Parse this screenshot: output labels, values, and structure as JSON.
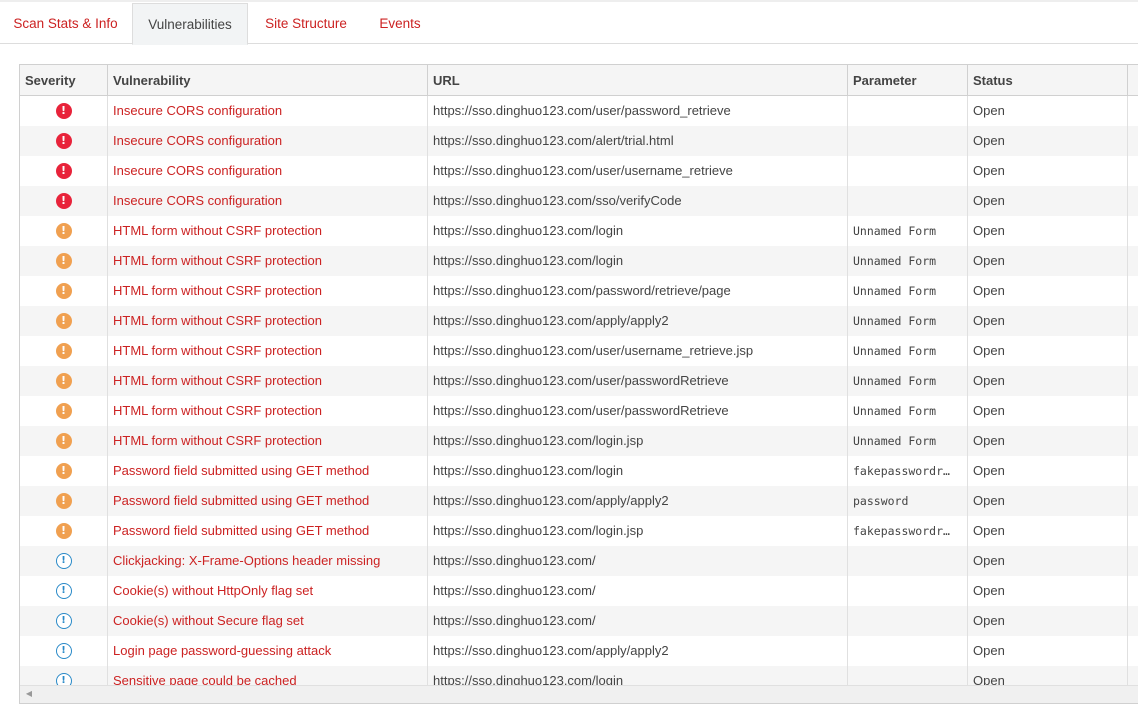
{
  "tabs": [
    {
      "label": "Scan Stats & Info",
      "active": false
    },
    {
      "label": "Vulnerabilities",
      "active": true
    },
    {
      "label": "Site Structure",
      "active": false
    },
    {
      "label": "Events",
      "active": false
    }
  ],
  "grid": {
    "columns": [
      "Severity",
      "Vulnerability",
      "URL",
      "Parameter",
      "Status"
    ],
    "rows": [
      {
        "severity": "high",
        "vulnerability": "Insecure CORS configuration",
        "url": "https://sso.dinghuo123.com/user/password_retrieve",
        "parameter": "",
        "status": "Open"
      },
      {
        "severity": "high",
        "vulnerability": "Insecure CORS configuration",
        "url": "https://sso.dinghuo123.com/alert/trial.html",
        "parameter": "",
        "status": "Open"
      },
      {
        "severity": "high",
        "vulnerability": "Insecure CORS configuration",
        "url": "https://sso.dinghuo123.com/user/username_retrieve",
        "parameter": "",
        "status": "Open"
      },
      {
        "severity": "high",
        "vulnerability": "Insecure CORS configuration",
        "url": "https://sso.dinghuo123.com/sso/verifyCode",
        "parameter": "",
        "status": "Open"
      },
      {
        "severity": "medium",
        "vulnerability": "HTML form without CSRF protection",
        "url": "https://sso.dinghuo123.com/login",
        "parameter": "Unnamed Form",
        "status": "Open"
      },
      {
        "severity": "medium",
        "vulnerability": "HTML form without CSRF protection",
        "url": "https://sso.dinghuo123.com/login",
        "parameter": "Unnamed Form",
        "status": "Open"
      },
      {
        "severity": "medium",
        "vulnerability": "HTML form without CSRF protection",
        "url": "https://sso.dinghuo123.com/password/retrieve/page",
        "parameter": "Unnamed Form",
        "status": "Open"
      },
      {
        "severity": "medium",
        "vulnerability": "HTML form without CSRF protection",
        "url": "https://sso.dinghuo123.com/apply/apply2",
        "parameter": "Unnamed Form",
        "status": "Open"
      },
      {
        "severity": "medium",
        "vulnerability": "HTML form without CSRF protection",
        "url": "https://sso.dinghuo123.com/user/username_retrieve.jsp",
        "parameter": "Unnamed Form",
        "status": "Open"
      },
      {
        "severity": "medium",
        "vulnerability": "HTML form without CSRF protection",
        "url": "https://sso.dinghuo123.com/user/passwordRetrieve",
        "parameter": "Unnamed Form",
        "status": "Open"
      },
      {
        "severity": "medium",
        "vulnerability": "HTML form without CSRF protection",
        "url": "https://sso.dinghuo123.com/user/passwordRetrieve",
        "parameter": "Unnamed Form",
        "status": "Open"
      },
      {
        "severity": "medium",
        "vulnerability": "HTML form without CSRF protection",
        "url": "https://sso.dinghuo123.com/login.jsp",
        "parameter": "Unnamed Form",
        "status": "Open"
      },
      {
        "severity": "medium",
        "vulnerability": "Password field submitted using GET method",
        "url": "https://sso.dinghuo123.com/login",
        "parameter": "fakepasswordr…",
        "status": "Open"
      },
      {
        "severity": "medium",
        "vulnerability": "Password field submitted using GET method",
        "url": "https://sso.dinghuo123.com/apply/apply2",
        "parameter": "password",
        "status": "Open"
      },
      {
        "severity": "medium",
        "vulnerability": "Password field submitted using GET method",
        "url": "https://sso.dinghuo123.com/login.jsp",
        "parameter": "fakepasswordr…",
        "status": "Open"
      },
      {
        "severity": "low",
        "vulnerability": "Clickjacking: X-Frame-Options header missing",
        "url": "https://sso.dinghuo123.com/",
        "parameter": "",
        "status": "Open"
      },
      {
        "severity": "low",
        "vulnerability": "Cookie(s) without HttpOnly flag set",
        "url": "https://sso.dinghuo123.com/",
        "parameter": "",
        "status": "Open"
      },
      {
        "severity": "low",
        "vulnerability": "Cookie(s) without Secure flag set",
        "url": "https://sso.dinghuo123.com/",
        "parameter": "",
        "status": "Open"
      },
      {
        "severity": "low",
        "vulnerability": "Login page password-guessing attack",
        "url": "https://sso.dinghuo123.com/apply/apply2",
        "parameter": "",
        "status": "Open"
      },
      {
        "severity": "low",
        "vulnerability": "Sensitive page could be cached",
        "url": "https://sso.dinghuo123.com/login",
        "parameter": "",
        "status": "Open"
      }
    ]
  },
  "severity_icons": {
    "high": {
      "icon": "exclamation-filled-icon",
      "glyph": "!",
      "color": "#e8233a"
    },
    "medium": {
      "icon": "exclamation-filled-icon",
      "glyph": "!",
      "color": "#f0a050"
    },
    "low": {
      "icon": "exclamation-outline-icon",
      "glyph": "!",
      "color": "#2a8ac8"
    }
  },
  "colors": {
    "accent_text": "#cc2222",
    "tab_active_bg": "#f2f4f5",
    "row_alt_bg": "#f5f5f5"
  },
  "scrollbar": {
    "left_arrow_glyph": "◀"
  }
}
